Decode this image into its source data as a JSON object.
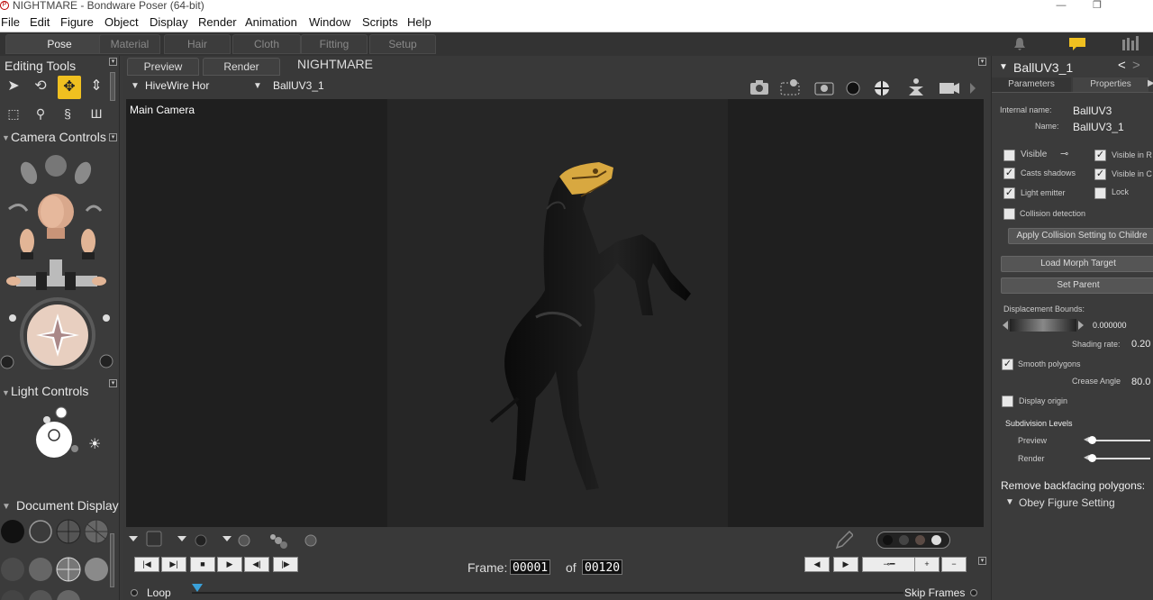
{
  "window": {
    "title": "NIGHTMARE - Bondware Poser (64-bit)",
    "app_icon": "P",
    "min": "—",
    "restore": "❐"
  },
  "menu": [
    "File",
    "Edit",
    "Figure",
    "Object",
    "Display",
    "Render",
    "Animation",
    "Window",
    "Scripts",
    "Help"
  ],
  "rooms": [
    "Pose",
    "Material",
    "Hair",
    "Cloth",
    "Fitting",
    "Setup"
  ],
  "left": {
    "editing_tools": "Editing Tools",
    "camera_controls": "Camera Controls",
    "light_controls": "Light Controls",
    "document_display": "Document  Display"
  },
  "document": {
    "tabs": [
      "Preview",
      "Render"
    ],
    "doc_title": "NIGHTMARE",
    "camera_select": "HiveWire Hor",
    "figure_select": "BallUV3_1",
    "viewport_label": "Main Camera"
  },
  "playback": {
    "frame_label": "Frame:",
    "current_frame": "00001",
    "of": "of",
    "total_frames": "00120",
    "loop": "Loop",
    "skip_frames": "Skip Frames"
  },
  "right": {
    "object_name": "BallUV3_1",
    "tabs": [
      "Parameters",
      "Properties"
    ],
    "internal_name_label": "Internal name:",
    "internal_name": "BallUV3",
    "name_label": "Name:",
    "name": "BallUV3_1",
    "visible": "Visible",
    "visible_in_r": "Visible in R",
    "casts_shadows": "Casts shadows",
    "visible_in_c": "Visible in C",
    "light_emitter": "Light emitter",
    "lock": "Lock",
    "collision_detection": "Collision detection",
    "apply_collision": "Apply Collision Setting to Childre",
    "load_morph": "Load Morph Target",
    "set_parent": "Set Parent",
    "displacement_bounds": "Displacement Bounds:",
    "displacement_value": "0.000000",
    "shading_rate_label": "Shading rate:",
    "shading_rate": "0.20",
    "smooth_polygons": "Smooth polygons",
    "crease_angle_label": "Crease Angle",
    "crease_angle": "80.0",
    "display_origin": "Display origin",
    "subdivision_levels": "Subdivision Levels",
    "preview": "Preview",
    "render": "Render",
    "remove_backfacing": "Remove backfacing polygons:",
    "obey_figure": "Obey Figure Setting"
  },
  "colors": {
    "accent": "#f0c020",
    "viewport_bg": "#1f1f1f",
    "panel_bg": "#3b3b3b"
  }
}
